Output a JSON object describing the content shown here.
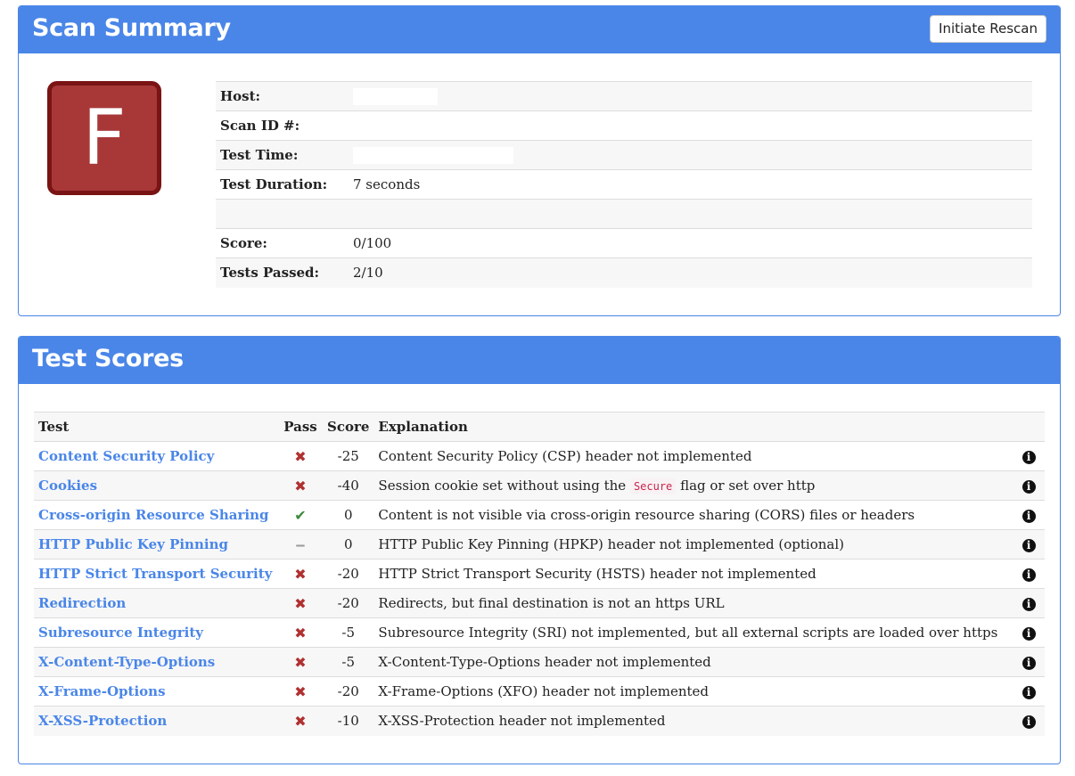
{
  "summary": {
    "title": "Scan Summary",
    "rescan_label": "Initiate Rescan",
    "grade": "F",
    "rows": [
      {
        "label": "Host:",
        "value": ""
      },
      {
        "label": "Scan ID #:",
        "value": ""
      },
      {
        "label": "Test Time:",
        "value": ""
      },
      {
        "label": "Test Duration:",
        "value": "7 seconds"
      },
      {
        "label": "",
        "value": ""
      },
      {
        "label": "Score:",
        "value": "0/100"
      },
      {
        "label": "Tests Passed:",
        "value": "2/10"
      }
    ]
  },
  "scores": {
    "title": "Test Scores",
    "headers": {
      "test": "Test",
      "pass": "Pass",
      "score": "Score",
      "explanation": "Explanation"
    },
    "rows": [
      {
        "test": "Content Security Policy",
        "pass": "fail",
        "score": "-25",
        "explanation": "Content Security Policy (CSP) header not implemented"
      },
      {
        "test": "Cookies",
        "pass": "fail",
        "score": "-40",
        "explanation_pre": "Session cookie set without using the ",
        "explanation_code": "Secure",
        "explanation_post": " flag or set over http"
      },
      {
        "test": "Cross-origin Resource Sharing",
        "pass": "pass",
        "score": "0",
        "explanation": "Content is not visible via cross-origin resource sharing (CORS) files or headers"
      },
      {
        "test": "HTTP Public Key Pinning",
        "pass": "neutral",
        "score": "0",
        "explanation": "HTTP Public Key Pinning (HPKP) header not implemented (optional)"
      },
      {
        "test": "HTTP Strict Transport Security",
        "pass": "fail",
        "score": "-20",
        "explanation": "HTTP Strict Transport Security (HSTS) header not implemented"
      },
      {
        "test": "Redirection",
        "pass": "fail",
        "score": "-20",
        "explanation": "Redirects, but final destination is not an https URL"
      },
      {
        "test": "Subresource Integrity",
        "pass": "fail",
        "score": "-5",
        "explanation": "Subresource Integrity (SRI) not implemented, but all external scripts are loaded over https"
      },
      {
        "test": "X-Content-Type-Options",
        "pass": "fail",
        "score": "-5",
        "explanation": "X-Content-Type-Options header not implemented"
      },
      {
        "test": "X-Frame-Options",
        "pass": "fail",
        "score": "-20",
        "explanation": "X-Frame-Options (XFO) header not implemented"
      },
      {
        "test": "X-XSS-Protection",
        "pass": "fail",
        "score": "-10",
        "explanation": "X-XSS-Protection header not implemented"
      }
    ]
  },
  "icons": {
    "fail": "cross-icon",
    "pass": "check-icon",
    "neutral": "dash-icon",
    "info": "info-icon"
  },
  "colors": {
    "accent": "#4a86e8",
    "grade_bg": "#a83838",
    "grade_border": "#7a1414",
    "fail": "#b03030",
    "pass": "#3a8a3a"
  }
}
